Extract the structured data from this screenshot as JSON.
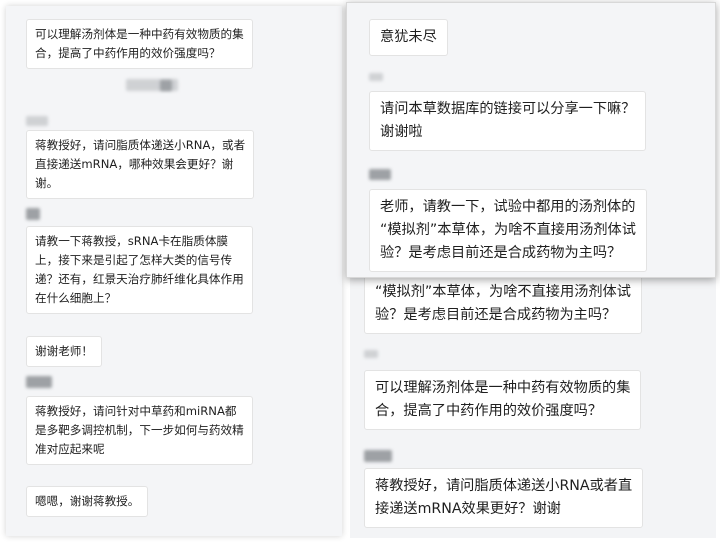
{
  "left_panel": {
    "messages": [
      "可以理解汤剂体是一种中药有效物质的集\n合，提高了中药作用的效价强度吗？",
      "蒋教授好，请问脂质体递送小RNA，或者\n直接递送mRNA，哪种效果会更好？谢\n谢。",
      "请教一下蒋教授，sRNA卡在脂质体膜\n上，接下来是引起了怎样大类的信号传\n递？还有，红景天治疗肺纤维化具体作用\n在什么细胞上？",
      "谢谢老师！",
      "蒋教授好，请问针对中草药和miRNA都\n是多靶多调控机制，下一步如何与药效精\n准对应起来呢",
      "嗯嗯，谢谢蒋教授。"
    ]
  },
  "right_top_panel": {
    "messages": [
      "意犹未尽",
      "请问本草数据库的链接可以分享一下嘛？\n谢谢啦",
      "老师，请教一下，试验中都用的汤剂体的\n“模拟剂”本草体，为啥不直接用汤剂体试\n验？是考虑目前还是合成药物为主吗？"
    ]
  },
  "right_bottom_panel": {
    "messages": [
      "“模拟剂”本草体，为啥不直接用汤剂体试\n验？是考虑目前还是合成药物为主吗？",
      "可以理解汤剂体是一种中药有效物质的集\n合，提高了中药作用的效价强度吗？",
      "蒋教授好，请问脂质体递送小RNA或者直\n接递送mRNA效果更好？谢谢"
    ]
  }
}
